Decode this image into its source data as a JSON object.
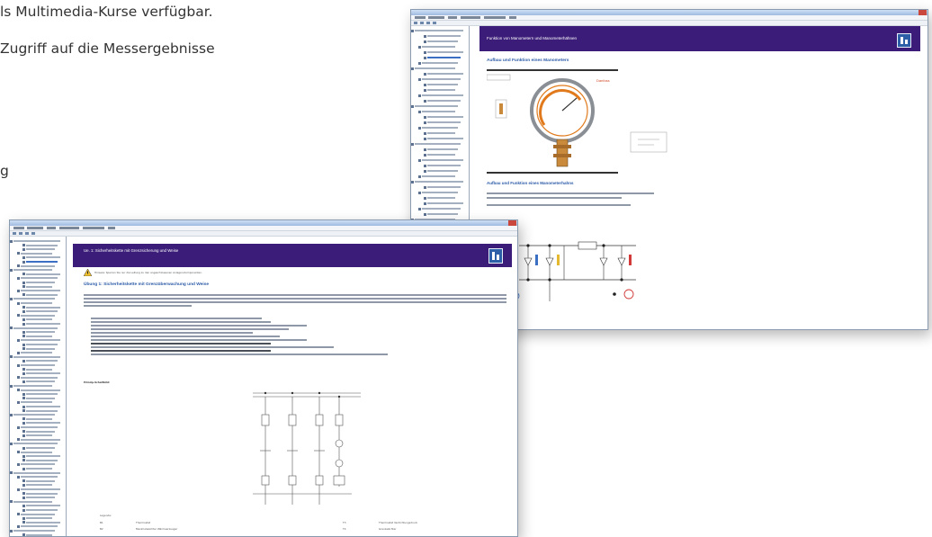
{
  "intro": {
    "line1": "ls Multimedia-Kurse verfügbar.",
    "line2": "Zugriff auf die Messergebnisse",
    "line3": "g"
  },
  "window_back": {
    "header_title": "Funktion von Manometern und Manometerhähnen",
    "section1_title": "Aufbau und Funktion eines Manometers",
    "section2_title": "Aufbau und Funktion eines Manometerhahns",
    "brand_label": "Danfoss"
  },
  "window_front": {
    "header_title": "Ue. 1: Sicherheitskette mit Grenzsicherung und Weise",
    "warning_text": "Hinweis: Sperren Sie nur die Leitung zu den angeschlossenen Anlagen-Komponenten.",
    "section_title": "Übung 1: Sicherheitskette mit Grenzüberwachung und Weise",
    "circuit_caption": "Prinzip-Schaltbild:",
    "legend": {
      "title": "Legende:",
      "rows": [
        {
          "code": "B1",
          "desc": "Thermostat",
          "code2": "T3",
          "desc2": "Thermostat Verdichtungsdruck"
        },
        {
          "code": "B2",
          "desc": "Maximalwächter Wärmeerzeuger",
          "code2": "T4",
          "desc2": "Grenzwächter"
        }
      ]
    }
  },
  "colors": {
    "header": "#3b1d79",
    "section": "#2b5aa7",
    "tree_selected": "#3a6fc4",
    "gauge": "#e07a1c",
    "valve": "#c98a3c"
  }
}
